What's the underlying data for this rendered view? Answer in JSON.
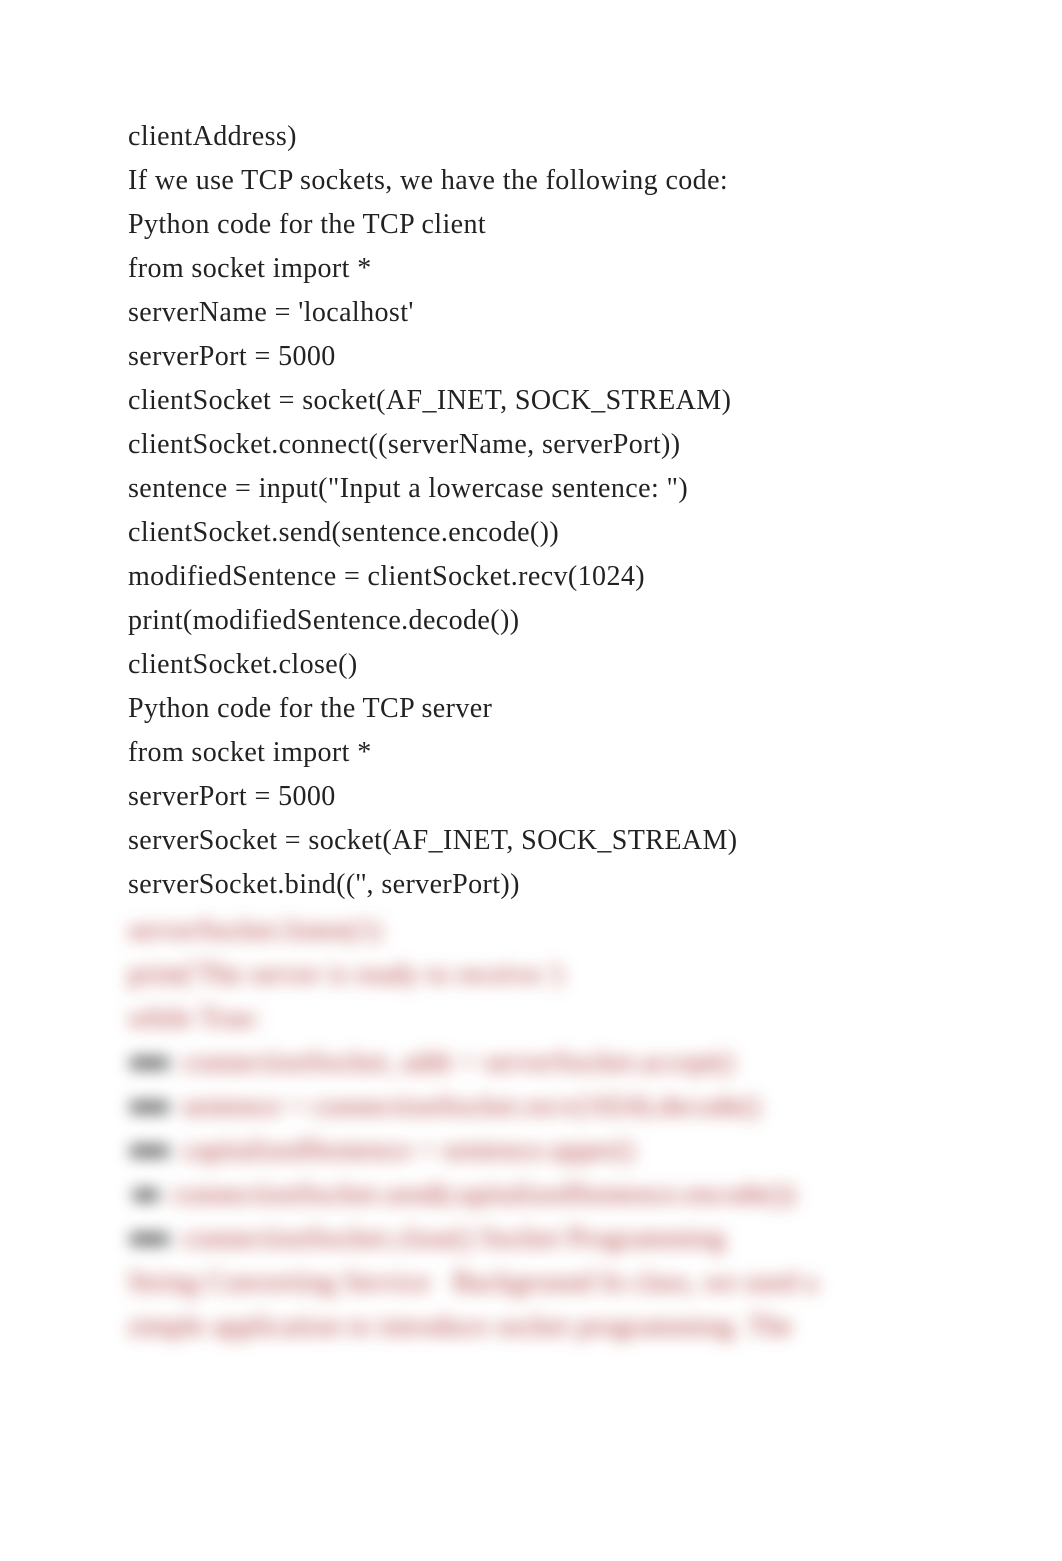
{
  "lines": [
    "clientAddress)",
    "If we use TCP sockets, we have the following code:",
    "Python code for the TCP client",
    "from socket import *",
    "serverName = 'localhost'",
    "serverPort = 5000",
    "clientSocket = socket(AF_INET, SOCK_STREAM)",
    "clientSocket.connect((serverName, serverPort))",
    "sentence = input(\"Input a lowercase sentence: \")",
    "clientSocket.send(sentence.encode())",
    "modifiedSentence = clientSocket.recv(1024)",
    "print(modifiedSentence.decode())",
    "clientSocket.close()",
    "Python code for the TCP server",
    "from socket import *",
    "serverPort = 5000",
    "serverSocket = socket(AF_INET, SOCK_STREAM)",
    "serverSocket.bind(('', serverPort))"
  ],
  "blurred_lines": [
    {
      "prefix": "",
      "text": "serverSocket.listen(1)"
    },
    {
      "prefix": "",
      "text": "print('The server is ready to receive.')"
    },
    {
      "prefix": "",
      "text": "while True:"
    },
    {
      "prefix": "●●● ",
      "text": "connectionSocket, addr = serverSocket.accept()"
    },
    {
      "prefix": "●●● ",
      "text": "sentence = connectionSocket.recv(1024).decode()"
    },
    {
      "prefix": "●●● ",
      "text": "capitalizedSentence = sentence.upper()"
    },
    {
      "prefix": " ●● ",
      "text": "connectionSocket.send(capitalizedSentence.encode())"
    },
    {
      "prefix": "●●● ",
      "text": "connectionSocket.close() Socket Programming"
    },
    {
      "prefix": "",
      "text": "String Converting Service   Background In class, we used a"
    },
    {
      "prefix": "",
      "text": "simple application to introduce socket programming. The"
    }
  ]
}
